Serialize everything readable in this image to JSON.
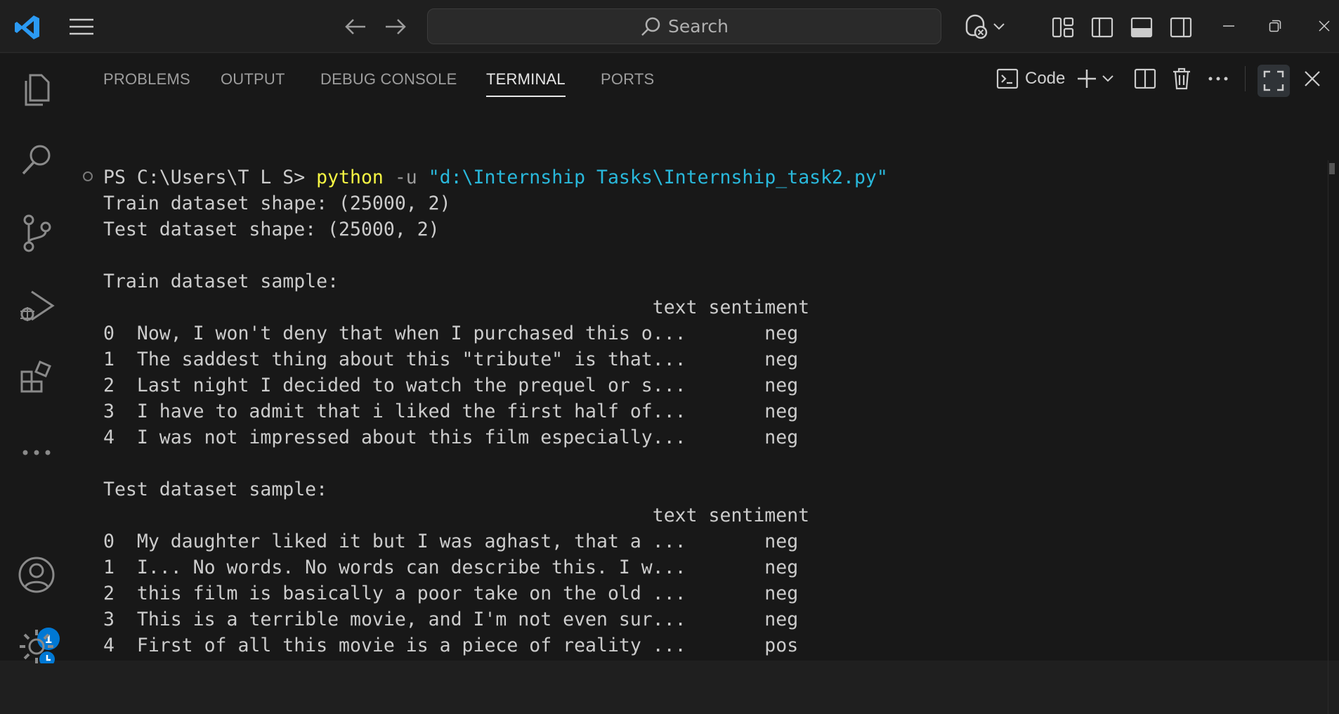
{
  "titlebar": {
    "search_placeholder": "Search",
    "icons": [
      "vscode-logo",
      "menu-icon",
      "back-arrow-icon",
      "forward-arrow-icon",
      "copilot-icon",
      "chevron-down-icon",
      "customize-layout-icon",
      "toggle-primary-sidebar-icon",
      "toggle-panel-icon",
      "toggle-secondary-sidebar-icon",
      "minimize-icon",
      "restore-icon",
      "close-icon"
    ]
  },
  "activitybar": {
    "icons": [
      "explorer-icon",
      "search-icon",
      "source-control-icon",
      "run-debug-icon",
      "extensions-icon",
      "more-icon",
      "account-icon",
      "manage-gear-icon"
    ],
    "account_badge": "1"
  },
  "panel": {
    "tabs": [
      {
        "label": "PROBLEMS"
      },
      {
        "label": "OUTPUT"
      },
      {
        "label": "DEBUG CONSOLE"
      },
      {
        "label": "TERMINAL"
      },
      {
        "label": "PORTS"
      }
    ],
    "active_tab": "TERMINAL",
    "terminal_profile_label": "Code"
  },
  "terminal": {
    "prompt": "PS C:\\Users\\T L S> ",
    "command": "python",
    "flag": " -u ",
    "arg": "\"d:\\Internship Tasks\\Internship_task2.py\"",
    "lines": [
      "Train dataset shape: (25000, 2)",
      "Test dataset shape: (25000, 2)",
      "",
      "Train dataset sample:",
      "                                                 text sentiment",
      "0  Now, I won't deny that when I purchased this o...       neg",
      "1  The saddest thing about this \"tribute\" is that...       neg",
      "2  Last night I decided to watch the prequel or s...       neg",
      "3  I have to admit that i liked the first half of...       neg",
      "4  I was not impressed about this film especially...       neg",
      "",
      "Test dataset sample:",
      "                                                 text sentiment",
      "0  My daughter liked it but I was aghast, that a ...       neg",
      "1  I... No words. No words can describe this. I w...       neg",
      "2  this film is basically a poor take on the old ...       neg",
      "3  This is a terrible movie, and I'm not even sur...       neg",
      "4  First of all this movie is a piece of reality ...       pos"
    ]
  }
}
